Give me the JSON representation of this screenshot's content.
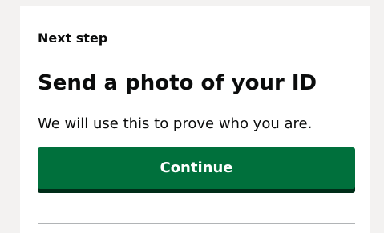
{
  "panel": {
    "caption": "Next step",
    "heading": "Send a photo of your ID",
    "body": "We will use this to prove who you are.",
    "continue_label": "Continue"
  },
  "colors": {
    "button": "#00703c",
    "button_shadow": "#002d18",
    "page_background": "#f3f2f1",
    "divider": "#b1b4b6"
  }
}
